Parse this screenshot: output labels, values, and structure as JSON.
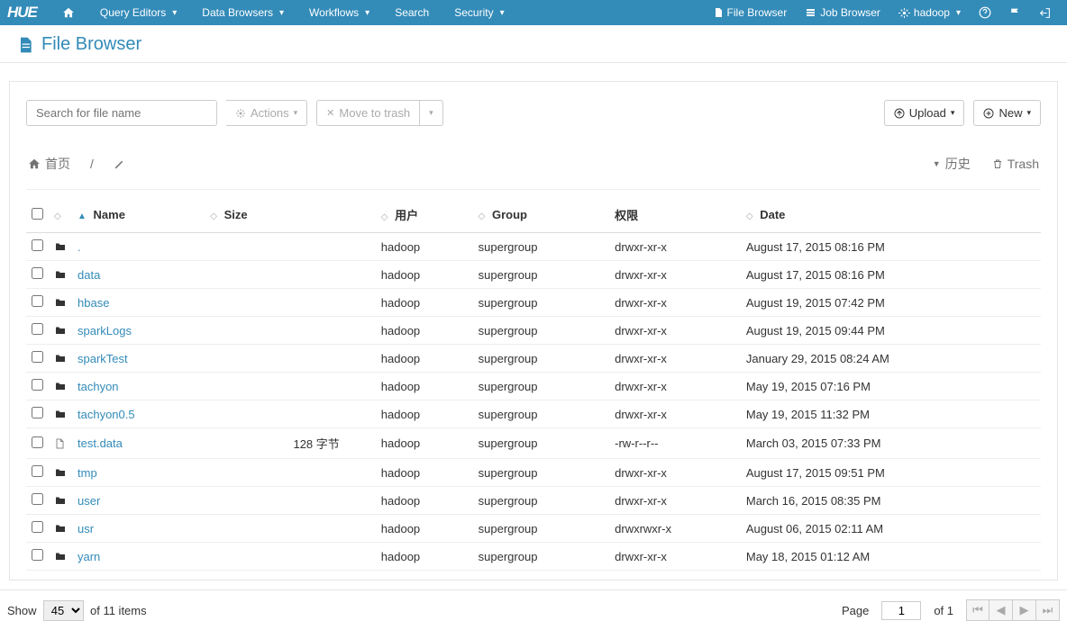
{
  "nav": {
    "logo": "HUE",
    "items": [
      "Query Editors",
      "Data Browsers",
      "Workflows",
      "Search",
      "Security"
    ],
    "dropdown_flags": [
      true,
      true,
      true,
      false,
      true
    ],
    "right": {
      "file_browser": "File Browser",
      "job_browser": "Job Browser",
      "user": "hadoop"
    }
  },
  "page": {
    "title": "File Browser"
  },
  "toolbar": {
    "search_placeholder": "Search for file name",
    "actions": "Actions",
    "move_trash": "Move to trash",
    "upload": "Upload",
    "new": "New"
  },
  "crumbs": {
    "home": "首页",
    "history": "历史",
    "trash": "Trash"
  },
  "columns": {
    "name": "Name",
    "size": "Size",
    "user": "用户",
    "group": "Group",
    "perm": "权限",
    "date": "Date"
  },
  "rows": [
    {
      "icon": "folder",
      "name": ".",
      "size": "",
      "user": "hadoop",
      "group": "supergroup",
      "perm": "drwxr-xr-x",
      "date": "August 17, 2015 08:16 PM"
    },
    {
      "icon": "folder",
      "name": "data",
      "size": "",
      "user": "hadoop",
      "group": "supergroup",
      "perm": "drwxr-xr-x",
      "date": "August 17, 2015 08:16 PM"
    },
    {
      "icon": "folder",
      "name": "hbase",
      "size": "",
      "user": "hadoop",
      "group": "supergroup",
      "perm": "drwxr-xr-x",
      "date": "August 19, 2015 07:42 PM"
    },
    {
      "icon": "folder",
      "name": "sparkLogs",
      "size": "",
      "user": "hadoop",
      "group": "supergroup",
      "perm": "drwxr-xr-x",
      "date": "August 19, 2015 09:44 PM"
    },
    {
      "icon": "folder",
      "name": "sparkTest",
      "size": "",
      "user": "hadoop",
      "group": "supergroup",
      "perm": "drwxr-xr-x",
      "date": "January 29, 2015 08:24 AM"
    },
    {
      "icon": "folder",
      "name": "tachyon",
      "size": "",
      "user": "hadoop",
      "group": "supergroup",
      "perm": "drwxr-xr-x",
      "date": "May 19, 2015 07:16 PM"
    },
    {
      "icon": "folder",
      "name": "tachyon0.5",
      "size": "",
      "user": "hadoop",
      "group": "supergroup",
      "perm": "drwxr-xr-x",
      "date": "May 19, 2015 11:32 PM"
    },
    {
      "icon": "file",
      "name": "test.data",
      "size": "128 字节",
      "user": "hadoop",
      "group": "supergroup",
      "perm": "-rw-r--r--",
      "date": "March 03, 2015 07:33 PM"
    },
    {
      "icon": "folder",
      "name": "tmp",
      "size": "",
      "user": "hadoop",
      "group": "supergroup",
      "perm": "drwxr-xr-x",
      "date": "August 17, 2015 09:51 PM"
    },
    {
      "icon": "folder",
      "name": "user",
      "size": "",
      "user": "hadoop",
      "group": "supergroup",
      "perm": "drwxr-xr-x",
      "date": "March 16, 2015 08:35 PM"
    },
    {
      "icon": "folder",
      "name": "usr",
      "size": "",
      "user": "hadoop",
      "group": "supergroup",
      "perm": "drwxrwxr-x",
      "date": "August 06, 2015 02:11 AM"
    },
    {
      "icon": "folder",
      "name": "yarn",
      "size": "",
      "user": "hadoop",
      "group": "supergroup",
      "perm": "drwxr-xr-x",
      "date": "May 18, 2015 01:12 AM"
    }
  ],
  "footer": {
    "show": "Show",
    "page_size": "45",
    "of_items": "of 11 items",
    "page_label": "Page",
    "page": "1",
    "of": "of 1"
  }
}
